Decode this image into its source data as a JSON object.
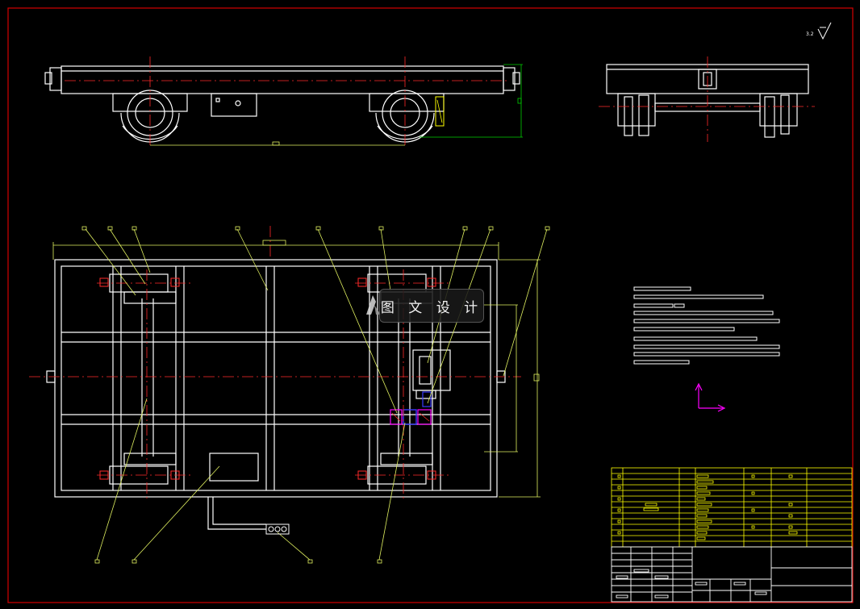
{
  "drawing": {
    "watermark_text": "图 文 设 计",
    "corner_symbol_text": "3.2",
    "colors": {
      "background": "#000000",
      "border": "#d40000",
      "outline": "#ffffff",
      "centerline": "#ff2a2a",
      "dimension": "#e0f060",
      "hatch_yellow": "#ffff00",
      "accent_magenta": "#ff00ff",
      "accent_blue": "#3a3aff",
      "dim_green": "#00d000"
    },
    "icons": [
      "watermark-logo-icon",
      "roughness-symbol-icon",
      "coordinate-axes-icon",
      "cable-junction-box-icon"
    ]
  }
}
